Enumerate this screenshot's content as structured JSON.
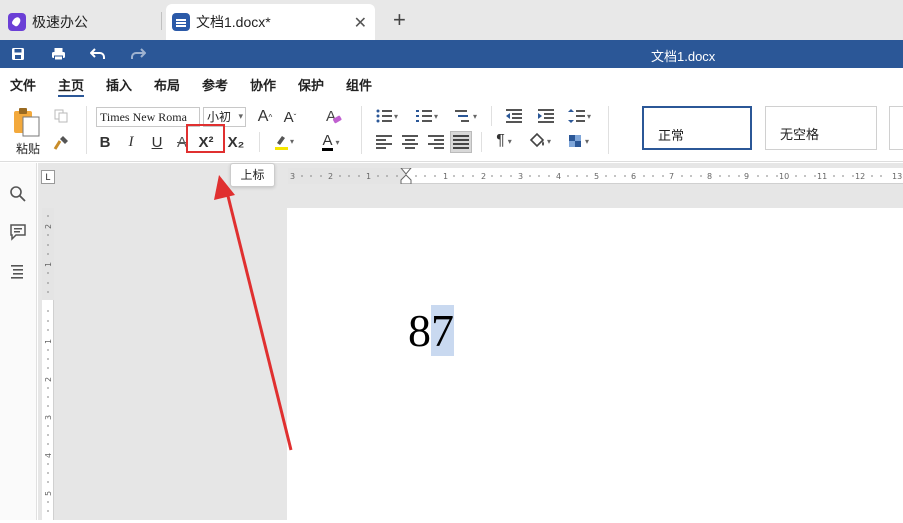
{
  "tabs": {
    "home_label": "极速办公",
    "doc_label": "文档1.docx*"
  },
  "titlebar": {
    "doc_title": "文档1.docx"
  },
  "menu": [
    "文件",
    "主页",
    "插入",
    "布局",
    "参考",
    "协作",
    "保护",
    "组件"
  ],
  "ribbon": {
    "paste_label": "粘贴",
    "font_name": "Times New Roma",
    "font_size": "小初",
    "bold": "B",
    "italic": "I",
    "underline": "U",
    "strikethrough": "A",
    "superscript": "X²",
    "subscript": "X₂",
    "font_color_letter": "A",
    "pilcrow": "¶",
    "styles": [
      "正常",
      "无空格"
    ]
  },
  "tooltip": "上标",
  "document": {
    "text_before": "8",
    "text_selected": "7"
  },
  "colors": {
    "titlebar": "#2b5797",
    "highlight_box": "#e03030",
    "arrow": "#e03030",
    "selection": "#c9d9f0"
  }
}
